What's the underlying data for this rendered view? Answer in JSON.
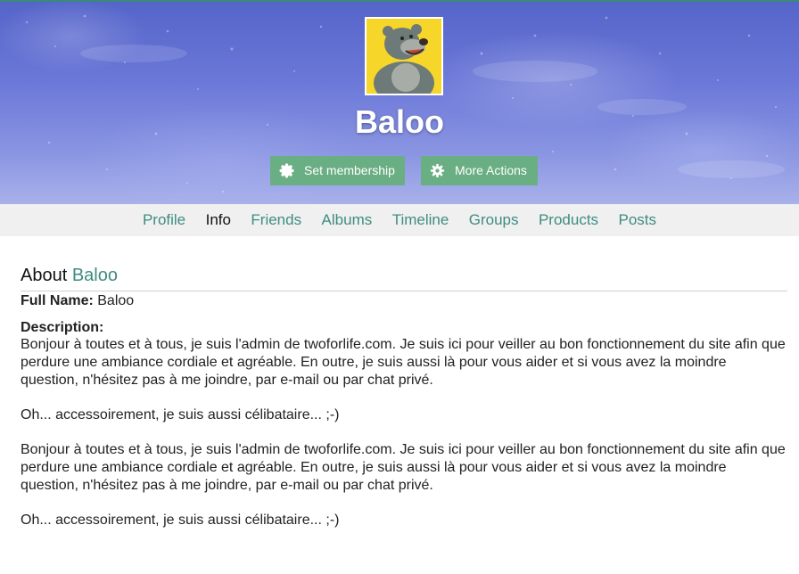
{
  "profile": {
    "name": "Baloo"
  },
  "actions": {
    "set_membership": "Set membership",
    "more_actions": "More Actions"
  },
  "tabs": [
    {
      "label": "Profile"
    },
    {
      "label": "Info"
    },
    {
      "label": "Friends"
    },
    {
      "label": "Albums"
    },
    {
      "label": "Timeline"
    },
    {
      "label": "Groups"
    },
    {
      "label": "Products"
    },
    {
      "label": "Posts"
    }
  ],
  "active_tab": "Info",
  "about": {
    "heading_prefix": "About",
    "heading_name": "Baloo",
    "full_name_label": "Full Name:",
    "full_name_value": "Baloo",
    "description_label": "Description:",
    "description": [
      "Bonjour à toutes et à tous, je suis l'admin de twoforlife.com. Je suis ici pour veiller au bon fonctionnement du site afin que perdure une ambiance cordiale et agréable. En outre, je suis aussi là pour vous aider et si vous avez la moindre question, n'hésitez pas à me joindre, par e-mail ou par chat privé.",
      "Oh... accessoirement, je suis aussi célibataire... ;-)",
      "Bonjour à toutes et à tous, je suis l'admin de twoforlife.com. Je suis ici pour veiller au bon fonctionnement du site afin que perdure une ambiance cordiale et agréable. En outre, je suis aussi là pour vous aider et si vous avez la moindre question, n'hésitez pas à me joindre, par e-mail ou par chat privé.",
      "Oh... accessoirement, je suis aussi célibataire... ;-)"
    ]
  },
  "colors": {
    "accent": "#3f8c80",
    "button": "#6aae83",
    "tab_bar": "#f0f0f0"
  },
  "icons": {
    "membership": "badge-icon",
    "more_actions": "gear-icon"
  }
}
